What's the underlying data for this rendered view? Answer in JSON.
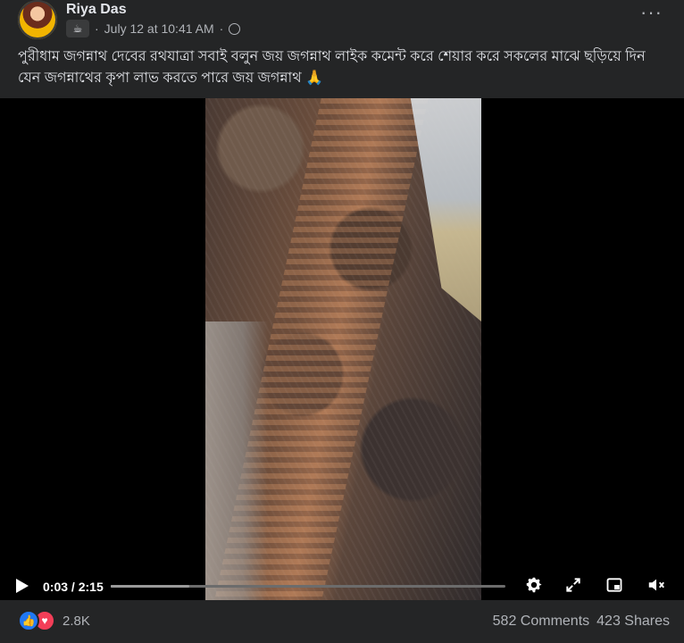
{
  "post": {
    "author": "Riya Das",
    "date": "July 12 at 10:41 AM",
    "separator": "·",
    "audience_icon": "globe-icon",
    "more_label": "···",
    "caption": "পুরীধাম জগন্নাথ দেবের রথযাত্রা সবাই বলুন জয় জগন্নাথ লাইক কমেন্ট করে শেয়ার করে সকলের মাঝে ছড়িয়ে দিন যেন জগন্নাথের কৃপা লাভ করতে পারে জয় জগন্নাথ 🙏"
  },
  "video": {
    "current_time": "0:03",
    "time_sep": " / ",
    "duration": "2:15",
    "progress": 0.022,
    "buffered": 0.2
  },
  "reactions": {
    "count": "2.8K",
    "types": [
      "like",
      "love"
    ]
  },
  "stats": {
    "comments": "582 Comments",
    "shares": "423 Shares"
  },
  "colors": {
    "background": "#242526",
    "text": "#e4e6eb",
    "secondary": "#b0b3b8",
    "like": "#2078f4",
    "love": "#f33e58"
  }
}
